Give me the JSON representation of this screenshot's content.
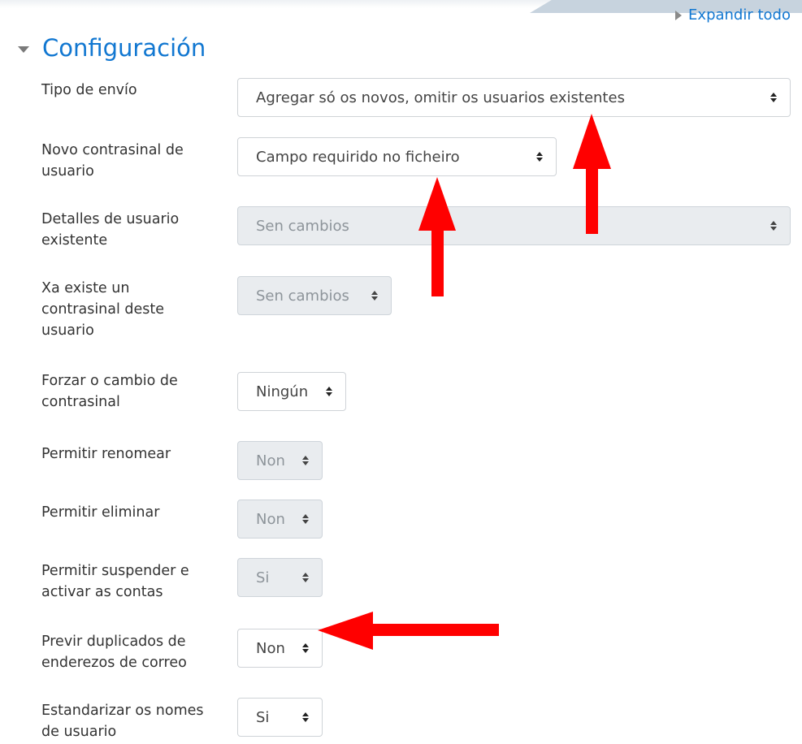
{
  "header": {
    "expand_all": "Expandir todo",
    "section_title": "Configuración"
  },
  "fields": [
    {
      "label": "Tipo de envío",
      "value": "Agregar só os novos, omitir os usuarios existentes",
      "disabled": false
    },
    {
      "label": "Novo contrasinal de usuario",
      "value": "Campo requirido no ficheiro",
      "disabled": false
    },
    {
      "label": "Detalles de usuario existente",
      "value": "Sen cambios",
      "disabled": true
    },
    {
      "label": "Xa existe un contrasinal deste usuario",
      "value": "Sen cambios",
      "disabled": true
    },
    {
      "label": "Forzar o cambio de contrasinal",
      "value": "Ningún",
      "disabled": false
    },
    {
      "label": "Permitir renomear",
      "value": "Non",
      "disabled": true
    },
    {
      "label": "Permitir eliminar",
      "value": "Non",
      "disabled": true
    },
    {
      "label": "Permitir suspender e activar as contas",
      "value": "Si",
      "disabled": true
    },
    {
      "label": "Previr duplicados de enderezos de correo",
      "value": "Non",
      "disabled": false
    },
    {
      "label": "Estandarizar os nomes de usuario",
      "value": "Si",
      "disabled": false
    }
  ],
  "annotation_color": "#ff0000"
}
